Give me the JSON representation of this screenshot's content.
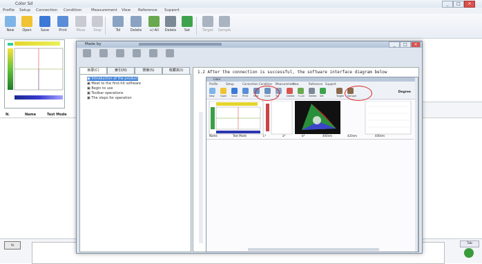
{
  "window": {
    "title": "Color Sd"
  },
  "menubar": [
    "Profile",
    "Setup",
    "Connection",
    "Condition",
    "Measurement",
    "View",
    "Reference",
    "Support"
  ],
  "toolbar": [
    {
      "label": "New",
      "icon": "new-file-icon",
      "color": "#7fb4e6"
    },
    {
      "label": "Open",
      "icon": "folder-open-icon",
      "color": "#f1c232"
    },
    {
      "label": "Save",
      "icon": "save-icon",
      "color": "#3c78d8"
    },
    {
      "label": "Print",
      "icon": "print-icon",
      "color": "#5b8ed6"
    },
    {
      "label": "Meas",
      "icon": "measure-icon",
      "color": "#c8ccd2",
      "disabled": true
    },
    {
      "label": "Stop",
      "icon": "stop-icon",
      "color": "#c8ccd2",
      "disabled": true
    },
    {
      "label": "Tol",
      "icon": "tolerance-icon",
      "color": "#8aa3c2"
    },
    {
      "label": "Delete",
      "icon": "delete-icon",
      "color": "#8aa3c2"
    },
    {
      "label": "+/-All",
      "icon": "add-remove-icon",
      "color": "#6aa84f"
    },
    {
      "label": "Delete",
      "icon": "delete-all-icon",
      "color": "#7b8896"
    },
    {
      "label": "Set",
      "icon": "settings-icon",
      "color": "#3fa34d"
    }
  ],
  "toolbar_extra": [
    "Target",
    "Sample"
  ],
  "left_columns": [
    "N.",
    "Name",
    "Test Mode"
  ],
  "dialog": {
    "title": "Made by",
    "buttons": [
      {
        "label": "",
        "icon": "print-icon"
      },
      {
        "label": "",
        "icon": "back-icon"
      },
      {
        "label": "",
        "icon": "forward-icon"
      },
      {
        "label": "",
        "icon": "home-icon"
      },
      {
        "label": "",
        "icon": "options-icon"
      },
      {
        "label": "",
        "icon": "page-icon"
      }
    ],
    "tabs": [
      "目录(C)",
      "索引(N)",
      "搜索(S)",
      "收藏夹(I)"
    ],
    "tree_items": [
      "Introduction of the product",
      "Meet to the first-hit software",
      "Begin to use",
      "Toolbar operations",
      "The steps for operation"
    ],
    "heading": "1.2  After the connection is successful, the software interface diagram below",
    "inner": {
      "strip_label": "Color",
      "menu": [
        "Profile",
        "Setup",
        "Connection",
        "Condition",
        "Measurement",
        "View",
        "Reference",
        "Support"
      ],
      "tools": [
        "New",
        "Open",
        "Save",
        "Print",
        "Mea",
        "Cont",
        "Tol",
        "Delete",
        "+/-All",
        "Delete",
        "Set",
        "Target",
        "Sample"
      ],
      "right_label": "Degree",
      "columns": [
        "Name",
        "Test Mode",
        "L*",
        "a*",
        "b*",
        "400nm",
        "420nm",
        "440nm"
      ]
    }
  },
  "bottom": {
    "tab_label": "Tab",
    "left_icon": "sample"
  },
  "colors": {
    "dialog_title": "#b2c3d8",
    "highlight": "#3d7fd6",
    "red_oval": "#dd2222"
  }
}
